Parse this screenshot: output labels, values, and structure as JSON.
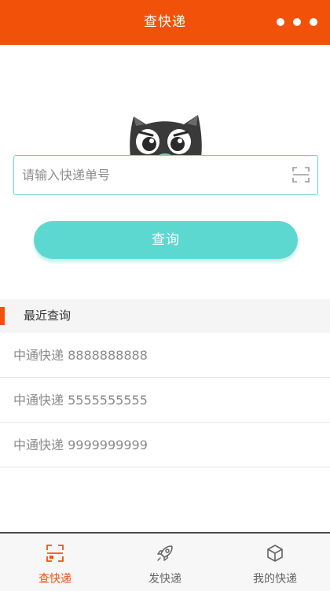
{
  "header": {
    "title": "查快递",
    "more_icon": "more-dots-icon"
  },
  "search": {
    "placeholder": "请输入快递单号",
    "value": "",
    "scan_icon": "scan-icon"
  },
  "query_button": {
    "label": "查询"
  },
  "recent": {
    "title": "最近查询",
    "items": [
      {
        "label": "中通快递 8888888888"
      },
      {
        "label": "中通快递 5555555555"
      },
      {
        "label": "中通快递 9999999999"
      }
    ]
  },
  "tabbar": {
    "tabs": [
      {
        "label": "查快递",
        "icon": "scan-icon",
        "active": true
      },
      {
        "label": "发快递",
        "icon": "rocket-icon",
        "active": false
      },
      {
        "label": "我的快递",
        "icon": "box-icon",
        "active": false
      }
    ]
  },
  "colors": {
    "brand": "#f2510a",
    "accent": "#5dd8d1"
  }
}
